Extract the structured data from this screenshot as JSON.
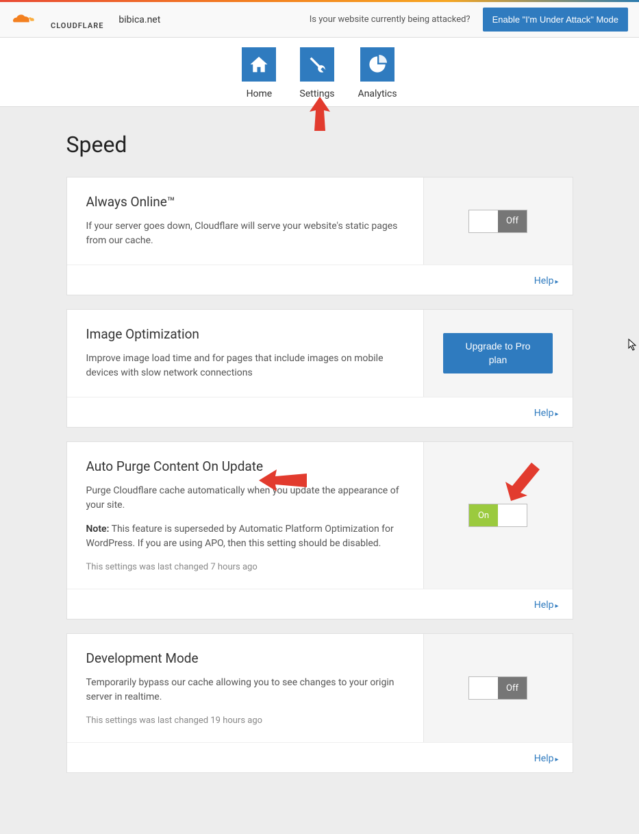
{
  "header": {
    "brand": "CLOUDFLARE",
    "domain": "bibica.net",
    "attack_question": "Is your website currently being attacked?",
    "attack_button": "Enable \"I'm Under Attack\" Mode"
  },
  "nav": {
    "home": "Home",
    "settings": "Settings",
    "analytics": "Analytics"
  },
  "page": {
    "title": "Speed",
    "help_label": "Help"
  },
  "cards": {
    "always_online": {
      "title": "Always Online™",
      "desc": "If your server goes down, Cloudflare will serve your website's static pages from our cache.",
      "toggle_state": "off",
      "toggle_text": "Off"
    },
    "image_opt": {
      "title": "Image Optimization",
      "desc": "Improve image load time and for pages that include images on mobile devices with slow network connections",
      "button": "Upgrade to Pro plan"
    },
    "auto_purge": {
      "title": "Auto Purge Content On Update",
      "desc": "Purge Cloudflare cache automatically when you update the appearance of your site.",
      "note_label": "Note:",
      "note_text": " This feature is superseded by Automatic Platform Optimization for WordPress. If you are using APO, then this setting should be disabled.",
      "meta": "This settings was last changed 7 hours ago",
      "toggle_state": "on",
      "toggle_text": "On"
    },
    "dev_mode": {
      "title": "Development Mode",
      "desc": "Temporarily bypass our cache allowing you to see changes to your origin server in realtime.",
      "meta": "This settings was last changed 19 hours ago",
      "toggle_state": "off",
      "toggle_text": "Off"
    }
  }
}
